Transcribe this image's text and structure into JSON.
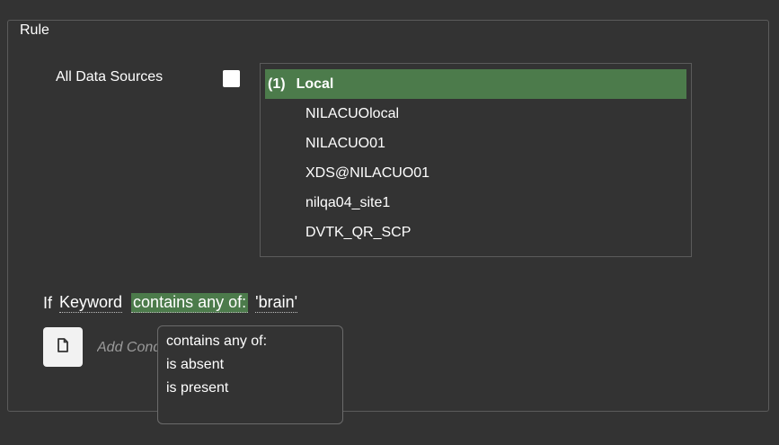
{
  "rule": {
    "legend": "Rule"
  },
  "data_sources": {
    "label": "All Data Sources",
    "checkbox_checked": false,
    "items": [
      {
        "index": "(1)",
        "label": "Local",
        "selected": true
      },
      {
        "label": "NILACUOlocal"
      },
      {
        "label": "NILACUO01"
      },
      {
        "label": "XDS@NILACUO01"
      },
      {
        "label": "nilqa04_site1"
      },
      {
        "label": "DVTK_QR_SCP"
      }
    ]
  },
  "condition": {
    "if_label": "If",
    "keyword": "Keyword",
    "operator": "contains any of:",
    "value": "'brain'"
  },
  "add_condition": {
    "label": "Add Condition",
    "icon": "document-icon"
  },
  "operator_dropdown": {
    "options": [
      "contains any of:",
      "is absent",
      "is present"
    ]
  },
  "colors": {
    "background": "#333333",
    "selection": "#4c7b4b",
    "border": "#5b5b5b"
  }
}
